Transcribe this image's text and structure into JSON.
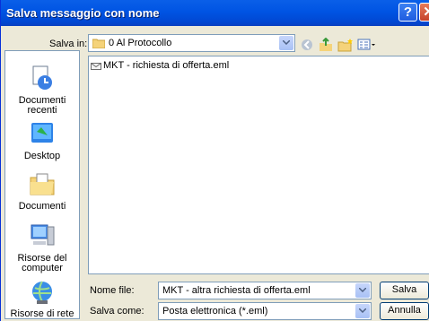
{
  "dialog": {
    "title": "Salva messaggio con nome"
  },
  "save_in": {
    "label": "Salva in:",
    "folder": "0 Al Protocollo"
  },
  "places": [
    {
      "label": "Documenti recenti",
      "icon": "recent-documents-icon"
    },
    {
      "label": "Desktop",
      "icon": "desktop-icon"
    },
    {
      "label": "Documenti",
      "icon": "documents-folder-icon"
    },
    {
      "label": "Risorse del computer",
      "icon": "my-computer-icon"
    },
    {
      "label": "Risorse di rete",
      "icon": "network-icon"
    }
  ],
  "files": [
    {
      "name": "MKT - richiesta di offerta.eml",
      "icon": "eml-file-icon"
    }
  ],
  "filename": {
    "label": "Nome file:",
    "value": "MKT - altra richiesta di offerta.eml"
  },
  "savetype": {
    "label": "Salva come:",
    "value": "Posta elettronica (*.eml)"
  },
  "buttons": {
    "save": "Salva",
    "cancel": "Annulla"
  },
  "colors": {
    "titlebar": "#0054e3",
    "dialog_bg": "#ece9d8",
    "border": "#7f9db9"
  }
}
